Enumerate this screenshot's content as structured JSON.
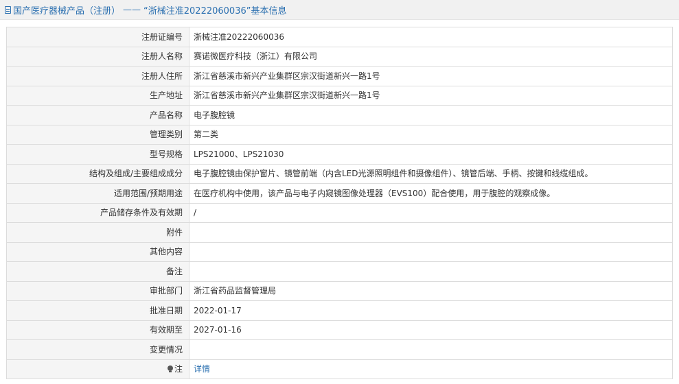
{
  "header": {
    "section": "国产医疗器械产品（注册）",
    "separator": "——",
    "title": "“浙械注准20222060036”基本信息"
  },
  "rows": [
    {
      "label": "注册证编号",
      "value": "浙械注准20222060036"
    },
    {
      "label": "注册人名称",
      "value": "赛诺微医疗科技（浙江）有限公司"
    },
    {
      "label": "注册人住所",
      "value": "浙江省慈溪市新兴产业集群区宗汉街道新兴一路1号"
    },
    {
      "label": "生产地址",
      "value": "浙江省慈溪市新兴产业集群区宗汉街道新兴一路1号"
    },
    {
      "label": "产品名称",
      "value": "电子腹腔镜"
    },
    {
      "label": "管理类别",
      "value": "第二类"
    },
    {
      "label": "型号规格",
      "value": "LPS21000、LPS21030"
    },
    {
      "label": "结构及组成/主要组成成分",
      "value": "电子腹腔镜由保护窗片、镜管前端（内含LED光源照明组件和摄像组件）、镜管后端、手柄、按键和线缆组成。"
    },
    {
      "label": "适用范围/预期用途",
      "value": "在医疗机构中使用，该产品与电子内窥镜图像处理器（EVS100）配合使用，用于腹腔的观察成像。"
    },
    {
      "label": "产品储存条件及有效期",
      "value": "/"
    },
    {
      "label": "附件",
      "value": ""
    },
    {
      "label": "其他内容",
      "value": ""
    },
    {
      "label": "备注",
      "value": ""
    },
    {
      "label": "审批部门",
      "value": "浙江省药品监督管理局"
    },
    {
      "label": "批准日期",
      "value": "2022-01-17"
    },
    {
      "label": "有效期至",
      "value": "2027-01-16"
    },
    {
      "label": "变更情况",
      "value": ""
    }
  ],
  "note": {
    "label": "注",
    "icon": "lightbulb-icon",
    "link_text": "详情"
  },
  "colors": {
    "link": "#2a6fb0",
    "label_bg": "#f5f5f5",
    "border": "#dcdcdc",
    "header_bg": "#f1f1f1"
  }
}
